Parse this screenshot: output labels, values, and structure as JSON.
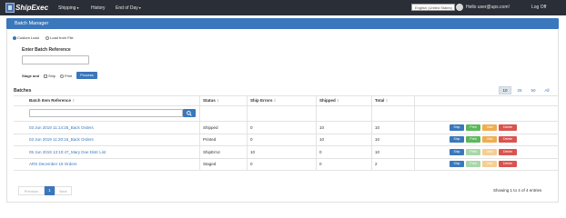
{
  "topbar": {
    "logo_text": "ShipExec",
    "menu": [
      {
        "label": "Shipping",
        "caret": "▾"
      },
      {
        "label": "History",
        "caret": ""
      },
      {
        "label": "End of Day",
        "caret": "▾"
      }
    ],
    "language": "English (United States)",
    "user": "Hello user@ups.com!",
    "logoff": "Log Off"
  },
  "page": {
    "title": "Batch Manager"
  },
  "load_options": {
    "custom": "Custom Load",
    "from_file": "Load from File"
  },
  "reference": {
    "label": "Enter Batch Reference",
    "value": ""
  },
  "stage": {
    "label": "Stage and",
    "ship": "Ship",
    "print": "Print",
    "process_button": "Process"
  },
  "batches": {
    "title": "Batches",
    "page_sizes": [
      "10",
      "25",
      "50",
      "All"
    ],
    "columns": {
      "ref": "Batch Item Reference",
      "status": "Status",
      "errors": "Ship Errors",
      "shipped": "Shipped",
      "total": "Total"
    },
    "sort_glyph": "⇕",
    "search_value": "",
    "action_labels": {
      "ship": "Ship",
      "print": "Print",
      "void": "Void",
      "delete": "Delete"
    },
    "rows": [
      {
        "ref": "03 Jun 2019 11:14:25_Back Orders",
        "status": "Shipped",
        "errors": "0",
        "shipped": "10",
        "total": "10"
      },
      {
        "ref": "03 Jun 2019 11:20:15_Back Orders",
        "status": "Printed",
        "errors": "0",
        "shipped": "10",
        "total": "10"
      },
      {
        "ref": "05 Jun 2019 13:10:47_Mary Doe Distr List",
        "status": "ShipError",
        "errors": "10",
        "shipped": "0",
        "total": "10"
      },
      {
        "ref": "ARS December 18 Orders",
        "status": "Staged",
        "errors": "0",
        "shipped": "0",
        "total": "2"
      }
    ]
  },
  "pagination": {
    "previous": "Previous",
    "current": "1",
    "next": "Next",
    "summary": "Showing 1 to 4 of 4 entries"
  },
  "colors": {
    "topbar": "#2a2e36",
    "accent": "#3a77bc",
    "print": "#5cb85c",
    "void": "#f0ad4e",
    "delete": "#d9534f"
  }
}
